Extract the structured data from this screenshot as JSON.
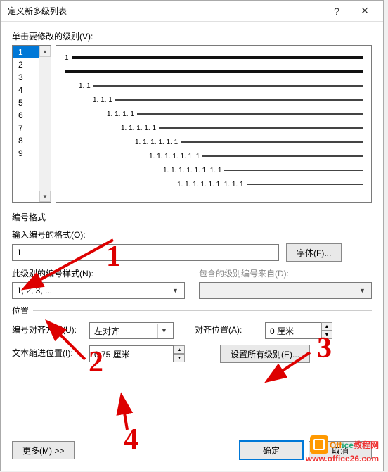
{
  "titlebar": {
    "title": "定义新多级列表",
    "help": "?",
    "close": "✕"
  },
  "levels_label": "单击要修改的级别(V):",
  "levels": [
    "1",
    "2",
    "3",
    "4",
    "5",
    "6",
    "7",
    "8",
    "9"
  ],
  "selected_level_index": 0,
  "preview": [
    {
      "num": "1",
      "indent": 0,
      "thick": true
    },
    {
      "num": "",
      "indent": 0,
      "thick": true
    },
    {
      "num": "1. 1",
      "indent": 20,
      "thick": false
    },
    {
      "num": "1. 1. 1",
      "indent": 40,
      "thick": false
    },
    {
      "num": "1. 1. 1. 1",
      "indent": 60,
      "thick": false
    },
    {
      "num": "1. 1. 1. 1. 1",
      "indent": 80,
      "thick": false
    },
    {
      "num": "1. 1. 1. 1. 1. 1",
      "indent": 100,
      "thick": false
    },
    {
      "num": "1. 1. 1. 1. 1. 1. 1",
      "indent": 120,
      "thick": false
    },
    {
      "num": "1. 1. 1. 1. 1. 1. 1. 1",
      "indent": 140,
      "thick": false
    },
    {
      "num": "1. 1. 1. 1. 1. 1. 1. 1. 1",
      "indent": 160,
      "thick": false
    }
  ],
  "format_group": "编号格式",
  "format_label": "输入编号的格式(O):",
  "format_value": "1",
  "font_button": "字体(F)...",
  "style_label": "此级别的编号样式(N):",
  "style_value": "1, 2, 3, ...",
  "include_label": "包含的级别编号来自(D):",
  "include_value": "",
  "position_group": "位置",
  "align_label": "编号对齐方式(U):",
  "align_value": "左对齐",
  "align_pos_label": "对齐位置(A):",
  "align_pos_value": "0 厘米",
  "indent_label": "文本缩进位置(I):",
  "indent_value": "0.75 厘米",
  "set_all_button": "设置所有级别(E)...",
  "more_button": "更多(M) >>",
  "ok_button": "确定",
  "cancel_button": "取消",
  "watermark": {
    "brand": "Office教程网",
    "url": "www.office26.com"
  },
  "annotations": {
    "a1": "1",
    "a2": "2",
    "a3": "3",
    "a4": "4"
  }
}
